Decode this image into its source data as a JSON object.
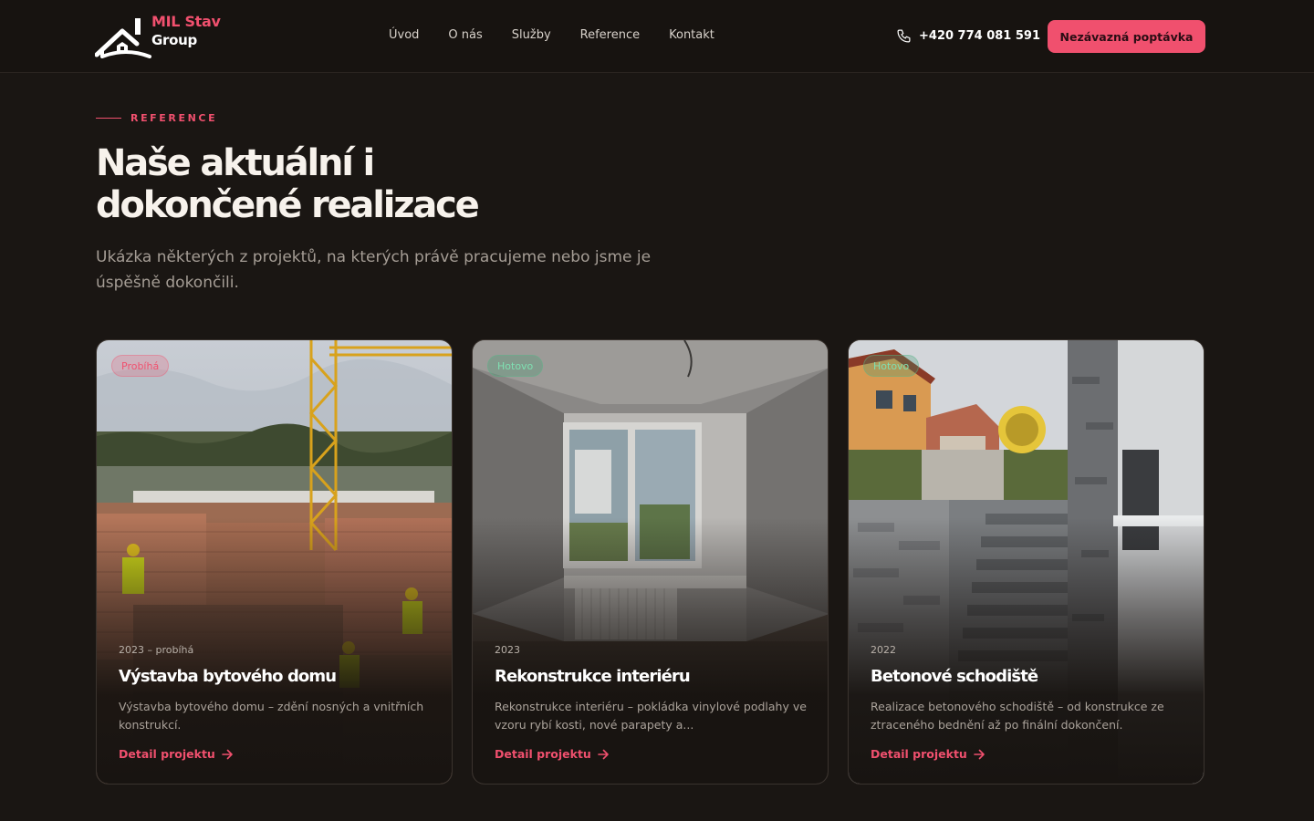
{
  "header": {
    "logo": {
      "line1": "MIL Stav",
      "line2": "Group"
    },
    "nav": [
      {
        "label": "Úvod"
      },
      {
        "label": "O nás"
      },
      {
        "label": "Služby"
      },
      {
        "label": "Reference"
      },
      {
        "label": "Kontakt"
      }
    ],
    "phone": "+420 774 081 591",
    "phone_icon": "phone-icon",
    "cta_label": "Nezávazná poptávka"
  },
  "intro": {
    "eyebrow": "REFERENCE",
    "title_line1": "Naše aktuální i",
    "title_line2": "dokončené realizace",
    "subtitle": "Ukázka některých z projektů, na kterých právě pracujeme nebo jsme je úspěšně dokončili."
  },
  "projects": [
    {
      "badge": "Probíhá",
      "status": "ongoing",
      "meta": "2023 – probíhá",
      "title": "Výstavba bytového domu",
      "description": "Výstavba bytového domu – zdění nosných a vnitřních konstrukcí.",
      "link": "Detail projektu"
    },
    {
      "badge": "Hotovo",
      "status": "done",
      "meta": "2023",
      "title": "Rekonstrukce interiéru",
      "description": "Rekonstrukce interiéru – pokládka vinylové podlahy ve vzoru rybí kosti, nové parapety a...",
      "link": "Detail projektu"
    },
    {
      "badge": "Hotovo",
      "status": "done",
      "meta": "2022",
      "title": "Betonové schodiště",
      "description": "Realizace betonového schodiště – od konstrukce ze ztraceného bednění až po finální dokončení.",
      "link": "Detail projektu"
    }
  ],
  "colors": {
    "accent": "#f0506e",
    "background": "#1a1613",
    "done_badge": "#7fe0b2"
  }
}
